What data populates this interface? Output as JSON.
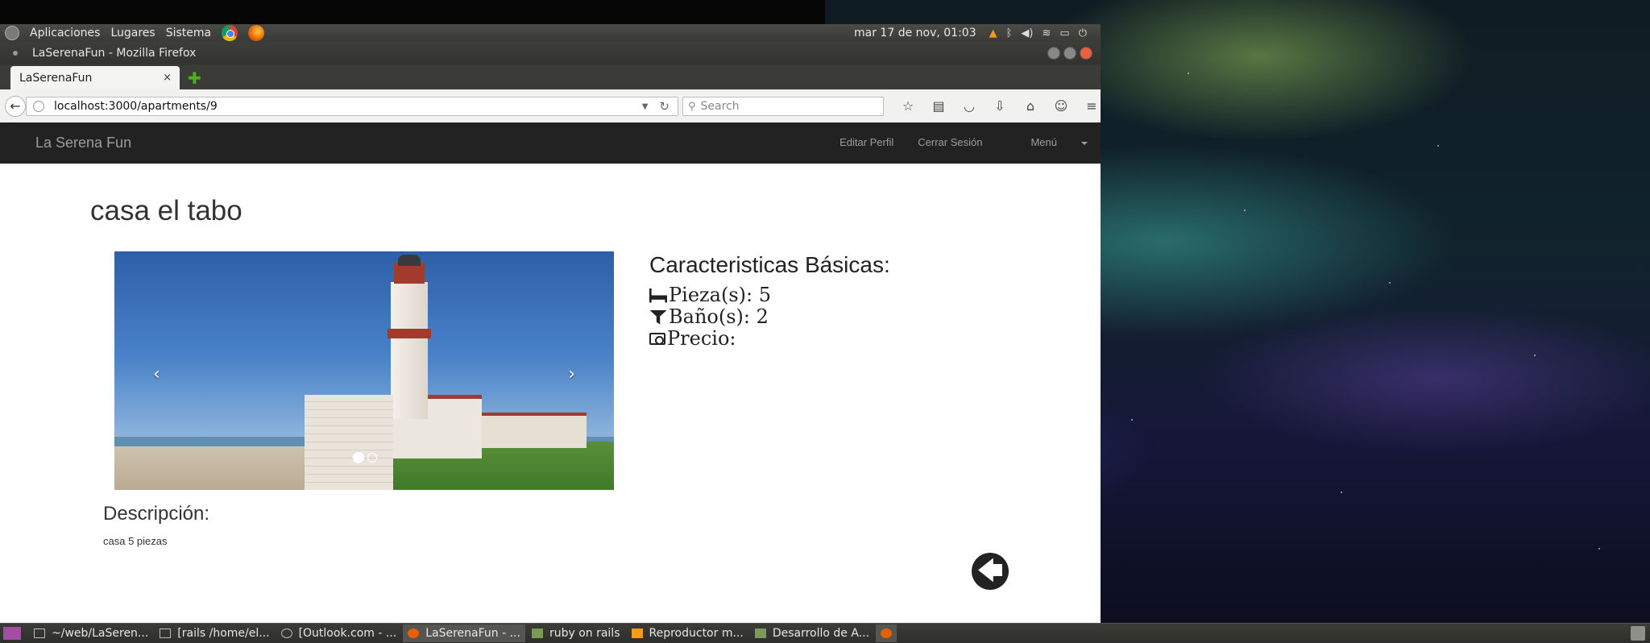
{
  "panel": {
    "menus": [
      "Aplicaciones",
      "Lugares",
      "Sistema"
    ],
    "clock": "mar 17 de nov, 01:03"
  },
  "browser": {
    "window_title": "LaSerenaFun - Mozilla Firefox",
    "tab_title": "LaSerenaFun",
    "tab_close": "×",
    "new_tab": "✚",
    "url": "localhost:3000/apartments/9",
    "search_placeholder": "Search"
  },
  "site": {
    "brand": "La Serena Fun",
    "nav": {
      "edit_profile": "Editar Perfil",
      "logout": "Cerrar Sesión",
      "menu": "Menú"
    }
  },
  "apartment": {
    "title": "casa el tabo",
    "features_title": "Caracteristicas Básicas:",
    "rooms": "Pieza(s): 5",
    "baths": "Baño(s): 2",
    "price": "Precio:",
    "description_title": "Descripción:",
    "description": "casa 5 piezas",
    "carousel": {
      "slides": 2,
      "active_slide": 1
    }
  },
  "taskbar": {
    "tasks": [
      "~/web/LaSeren...",
      "[rails  /home/el...",
      "[Outlook.com - ...",
      "LaSerenaFun - ...",
      "ruby on rails",
      "Reproductor m...",
      "Desarrollo de A..."
    ]
  }
}
